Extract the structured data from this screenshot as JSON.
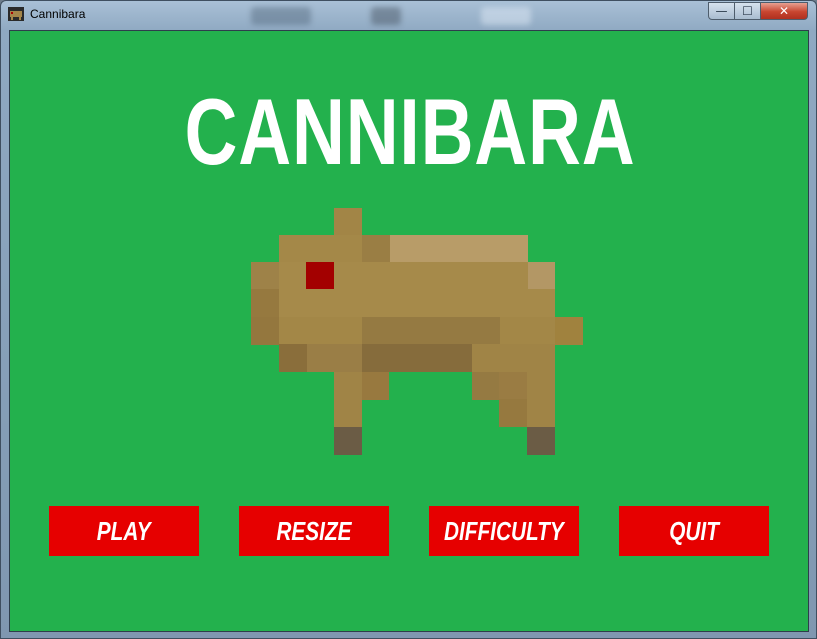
{
  "window": {
    "title": "Cannibara",
    "controls": {
      "minimize": "—",
      "maximize": "☐",
      "close": "✕"
    }
  },
  "game": {
    "title": "CANNIBARA",
    "background_color": "#23b14d",
    "sprite": "capybara-sprite",
    "menu": [
      {
        "id": "play",
        "label": "PLAY"
      },
      {
        "id": "resize",
        "label": "RESIZE"
      },
      {
        "id": "difficulty",
        "label": "DIFFICULTY"
      },
      {
        "id": "quit",
        "label": "QUIT"
      }
    ],
    "button_color": "#e60000"
  }
}
